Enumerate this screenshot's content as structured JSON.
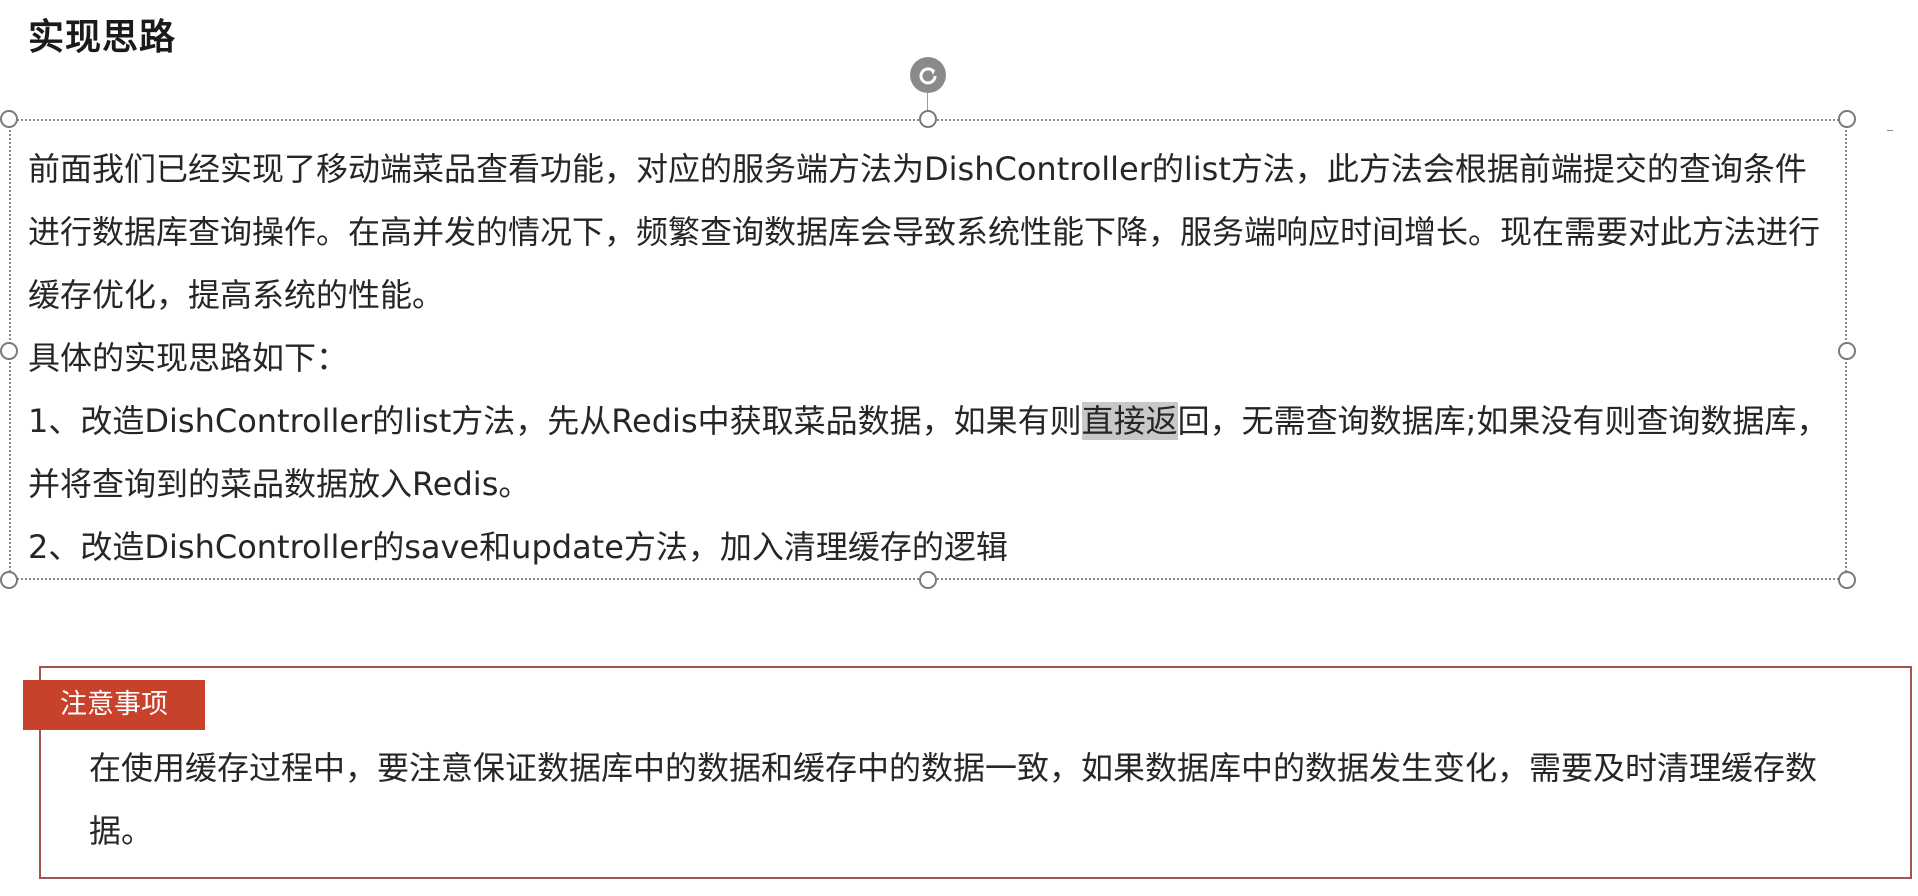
{
  "title": "实现思路",
  "content": {
    "para1": "前面我们已经实现了移动端菜品查看功能，对应的服务端方法为DishController的list方法，此方法会根据前端提交的查询条件进行数据库查询操作。在高并发的情况下，频繁查询数据库会导致系统性能下降，服务端响应时间增长。现在需要对此方法进行缓存优化，提高系统的性能。",
    "para2": "具体的实现思路如下：",
    "item1_before": "1、改造DishController的list方法，先从Redis中获取菜品数据，如果有则",
    "item1_highlight": "直接返",
    "item1_after": "回，无需查询数据库;如果没有则查询数据库，并将查询到的菜品数据放入Redis。",
    "item2": "2、改造DishController的save和update方法，加入清理缓存的逻辑"
  },
  "notice": {
    "tag": "注意事项",
    "text": "在使用缓存过程中，要注意保证数据库中的数据和缓存中的数据一致，如果数据库中的数据发生变化，需要及时清理缓存数据。"
  },
  "colors": {
    "notice_tag_bg": "#c8412a",
    "notice_border": "#a0564d",
    "highlight": "#c8c8c8"
  },
  "icons": {
    "rotate": "rotate-handle-icon"
  }
}
